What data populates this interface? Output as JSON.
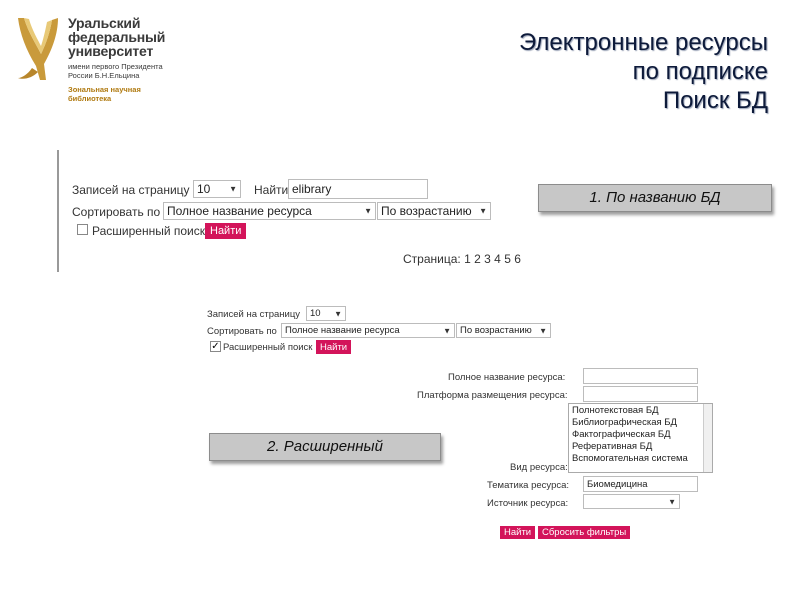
{
  "logo": {
    "line1": "Уральский",
    "line2": "федеральный",
    "line3": "университет",
    "sub1": "имени первого Президента",
    "sub2": "России Б.Н.Ельцина",
    "lib1": "Зональная научная",
    "lib2": "библиотека"
  },
  "title": {
    "line1": "Электронные ресурсы",
    "line2": "по подписке",
    "line3": "Поиск БД"
  },
  "form1": {
    "per_page_label": "Записей на страницу",
    "per_page_value": "10",
    "find_label": "Найти",
    "find_value": "elibrary",
    "sort_label": "Сортировать по",
    "sort_field_value": "Полное название ресурса",
    "sort_order_value": "По возрастанию",
    "advanced_label": "Расширенный поиск",
    "find_button": "Найти",
    "pages_label": "Страница:",
    "pages": [
      "1",
      "2",
      "3",
      "4",
      "5",
      "6"
    ]
  },
  "callouts": {
    "by_name": "1. По названию БД",
    "advanced": "2. Расширенный"
  },
  "form2": {
    "per_page_label": "Записей на страницу",
    "per_page_value": "10",
    "sort_label": "Сортировать по",
    "sort_field_value": "Полное название ресурса",
    "sort_order_value": "По возрастанию",
    "advanced_label": "Расширенный поиск",
    "advanced_checked": true,
    "find_button": "Найти",
    "full_name_label": "Полное название ресурса:",
    "full_name_value": "",
    "platform_label": "Платформа размещения ресурса:",
    "platform_value": "",
    "type_label": "Вид ресурса:",
    "type_options": [
      "Полнотекстовая БД",
      "Библиографическая БД",
      "Фактографическая БД",
      "Реферативная БД",
      "Вспомогательная система"
    ],
    "topic_label": "Тематика ресурса:",
    "topic_value": "Биомедицина",
    "source_label": "Источник ресурса:",
    "source_value": "",
    "find_button2": "Найти",
    "reset_button": "Сбросить фильтры"
  }
}
